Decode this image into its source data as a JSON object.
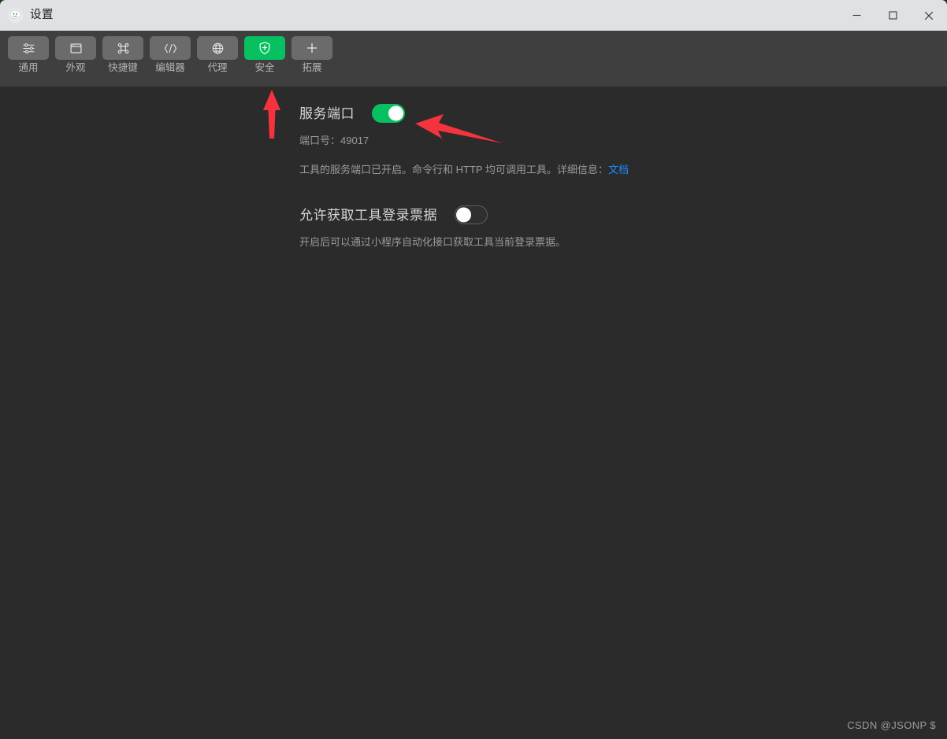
{
  "window": {
    "title": "设置",
    "app_icon": "wechat-devtools-icon",
    "controls": [
      {
        "name": "minimize",
        "icon": "minimize-icon"
      },
      {
        "name": "maximize",
        "icon": "maximize-icon"
      },
      {
        "name": "close",
        "icon": "close-icon"
      }
    ]
  },
  "toolbar": {
    "tabs": [
      {
        "label": "通用",
        "icon": "sliders-icon",
        "name": "tab-general",
        "active": false
      },
      {
        "label": "外观",
        "icon": "window-icon",
        "name": "tab-appearance",
        "active": false
      },
      {
        "label": "快捷键",
        "icon": "shortcut-icon",
        "name": "tab-shortcuts",
        "active": false
      },
      {
        "label": "编辑器",
        "icon": "code-icon",
        "name": "tab-editor",
        "active": false
      },
      {
        "label": "代理",
        "icon": "globe-icon",
        "name": "tab-proxy",
        "active": false
      },
      {
        "label": "安全",
        "icon": "shield-plus-icon",
        "name": "tab-security",
        "active": true
      },
      {
        "label": "拓展",
        "icon": "plus-icon",
        "name": "tab-extensions",
        "active": false
      }
    ]
  },
  "settings": {
    "service_port": {
      "title": "服务端口",
      "toggle_state": "on",
      "port_label": "端口号：",
      "port_value": "49017",
      "description_before": "工具的服务端口已开启。命令行和 HTTP 均可调用工具。详细信息：",
      "doc_link": "文档"
    },
    "login_ticket": {
      "title": "允许获取工具登录票据",
      "toggle_state": "off",
      "description": "开启后可以通过小程序自动化接口获取工具当前登录票据。"
    }
  },
  "annotations": {
    "arrow_up_target": "tab-security",
    "arrow_left_target": "service-port-toggle",
    "color": "#f5333f"
  },
  "watermark": "CSDN @JSONP $",
  "colors": {
    "accent_green": "#07c160",
    "titlebar_bg": "#dfe1e5",
    "toolbar_bg": "#3f3f3f",
    "content_bg": "#2b2b2b",
    "link_blue": "#1a8cff",
    "annotation_red": "#f5333f"
  }
}
